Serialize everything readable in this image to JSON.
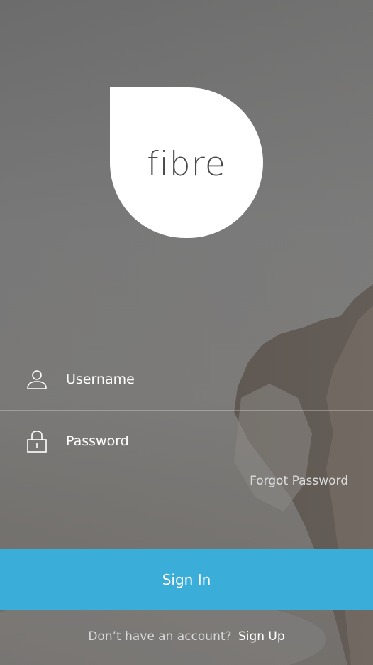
{
  "app": {
    "logo_text": "fibre"
  },
  "form": {
    "username": {
      "placeholder": "Username",
      "value": "",
      "icon": "user-icon"
    },
    "password": {
      "placeholder": "Password",
      "value": "",
      "icon": "lock-icon"
    },
    "forgot_label": "Forgot Password",
    "signin_label": "Sign In"
  },
  "footer": {
    "prompt": "Don’t have an account?",
    "signup_label": "Sign Up"
  },
  "colors": {
    "accent": "#3aaed8",
    "logo_background": "#ffffff",
    "logo_text": "#4a4a4a"
  }
}
